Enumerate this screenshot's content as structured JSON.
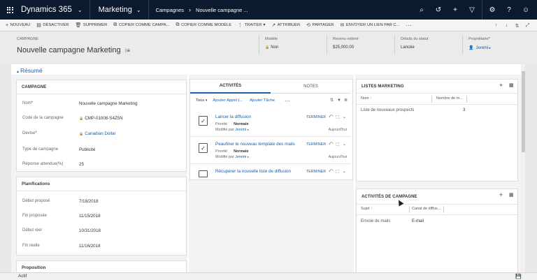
{
  "topnav": {
    "app_title": "Dynamics 365",
    "app_chevron": "⌄",
    "module": "Marketing",
    "module_chevron": "⌄",
    "crumbs": [
      "Campagnes",
      "Nouvelle campagne ..."
    ],
    "crumb_arrow": "›",
    "icons": {
      "search": "⌕",
      "history": "↺",
      "new": "+",
      "filter": "▽",
      "settings": "⚙",
      "help": "?",
      "user": "☺"
    }
  },
  "commandbar": {
    "items": [
      {
        "icon": "+",
        "label": "NOUVEAU"
      },
      {
        "icon": "▤",
        "label": "DÉSACTIVER"
      },
      {
        "icon": "🗑",
        "label": "SUPPRIMER"
      },
      {
        "icon": "⧉",
        "label": "COPIER COMME CAMPA..."
      },
      {
        "icon": "⧉",
        "label": "COPIER COMME MODÈLE"
      },
      {
        "icon": "⋮",
        "label": "TRAITER",
        "dropdown": "▾"
      },
      {
        "icon": "↗",
        "label": "ATTRIBUER"
      },
      {
        "icon": "⟲",
        "label": "PARTAGER"
      },
      {
        "icon": "✉",
        "label": "ENVOYER UN LIEN PAR C..."
      },
      {
        "icon": "",
        "label": "···"
      }
    ],
    "nav": [
      "↑",
      "↓",
      "⇅",
      "⤢"
    ]
  },
  "header": {
    "entity": "CAMPAGNE",
    "title": "Nouvelle campagne Marketing",
    "title_icon": "⁝≡",
    "fields": [
      {
        "label": "Modèle",
        "value": "Non",
        "locked": true
      },
      {
        "label": "Revenu estimé",
        "value": "$25,000.00"
      },
      {
        "label": "Détails du statut",
        "value": "Lancée"
      },
      {
        "label": "Propriétaire",
        "value": "Jeremi",
        "required": true,
        "link": true
      }
    ]
  },
  "section": {
    "title": "Résumé",
    "chevron": "▴"
  },
  "campaign_panel": {
    "title": "CAMPAGNE",
    "fields": [
      {
        "label": "Nom",
        "required": true,
        "value": "Nouvelle campagne Marketing"
      },
      {
        "label": "Code de la campagne",
        "value": "CMP-01008-S4Z5N",
        "locked": true
      },
      {
        "label": "Devise",
        "required": true,
        "value": "Canadian Dollar",
        "locked": true,
        "link": true
      },
      {
        "label": "Type de campagne",
        "value": "Publicité"
      },
      {
        "label": "Réponse attendue(%)",
        "value": "25"
      }
    ]
  },
  "plan_panel": {
    "title": "Planifications",
    "fields": [
      {
        "label": "Début proposé",
        "value": "7/18/2018"
      },
      {
        "label": "Fin proposée",
        "value": "11/15/2018"
      },
      {
        "label": "Début réel",
        "value": "10/31/2018"
      },
      {
        "label": "Fin réelle",
        "value": "11/16/2018"
      }
    ]
  },
  "proposition_panel": {
    "title": "Proposition"
  },
  "activities": {
    "tabs": [
      "ACTIVITÉS",
      "NOTES"
    ],
    "filter": "Tous",
    "filter_chevron": "▾",
    "add_call": "Ajouter Appel t...",
    "add_task": "Ajouter Tâche",
    "more": "···",
    "sort_icon": "⇅",
    "funnel_icon": "▼",
    "list_icon": "≣",
    "items": [
      {
        "title": "Lancer la diffusion",
        "priority_label": "Priorité",
        "priority": "Normale",
        "modified_label": "Modifié par",
        "modified_by": "Jeremi",
        "date": "Aujourd'hui",
        "finish": "TERMINER"
      },
      {
        "title": "Peaufiner le nouveau template des mails",
        "priority_label": "Priorité",
        "priority": "Normale",
        "modified_label": "Modifié par",
        "modified_by": "Jeremi",
        "date": "Aujourd'hui",
        "finish": "TERMINER"
      },
      {
        "title": "Récupérer la nouvelle liste de diffusion",
        "finish": "TERMINER"
      }
    ]
  },
  "marketing_lists": {
    "title": "LISTES MARKETING",
    "columns": [
      "Nom",
      "Nombre de m..."
    ],
    "rows": [
      {
        "name": "Liste de nouveaux prospects",
        "count": "3"
      }
    ]
  },
  "campaign_activities": {
    "title": "ACTIVITÉS DE CAMPAGNE",
    "columns": [
      "Sujet",
      "Canal de diffus..."
    ],
    "rows": [
      {
        "subject": "Envoie de mails",
        "channel": "E-mail"
      }
    ]
  },
  "status": {
    "text": "Actif",
    "save_icon": "💾"
  },
  "colors": {
    "nav_bg": "#0b1a2e",
    "link": "#1a5fa8",
    "required": "#dd0000"
  }
}
